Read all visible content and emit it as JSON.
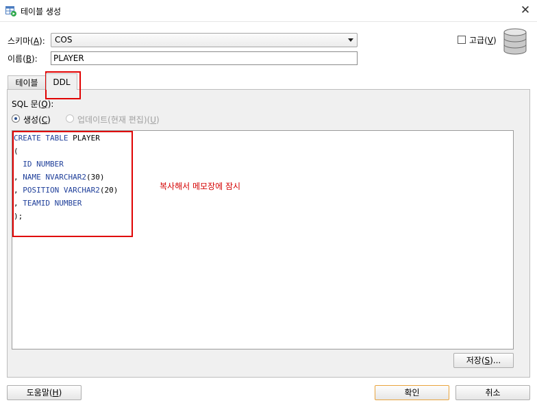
{
  "window": {
    "title": "테이블 생성",
    "close_symbol": "✕"
  },
  "form": {
    "schema_label": "스키마(A):",
    "schema_value": "COS",
    "name_label": "이름(B):",
    "name_value": "PLAYER",
    "advanced_label": "고급(V)",
    "advanced_checked": false
  },
  "tabs": [
    {
      "label": "테이블",
      "active": false
    },
    {
      "label": "DDL",
      "active": true
    }
  ],
  "ddl": {
    "sql_label": "SQL 문(Q):",
    "radio_create": "생성(C)",
    "radio_update": "업데이트(현재 편집)(U)",
    "code_lines": [
      "CREATE TABLE PLAYER",
      "(",
      "  ID NUMBER",
      ", NAME NVARCHAR2(30)",
      ", POSITION VARCHAR2(20)",
      ", TEAMID NUMBER",
      ");"
    ],
    "annotation": "복사해서 메모장에 잠시",
    "save_button": "저장(S)..."
  },
  "footer": {
    "help_button": "도움말(H)",
    "ok_button": "확인",
    "cancel_button": "취소"
  },
  "icons": {
    "title_icon": "create-table-icon",
    "database_icon": "database-icon"
  },
  "colors": {
    "annotation_red": "#e00000",
    "keyword_blue": "#1f3f9a",
    "primary_border": "#e8a33c"
  }
}
